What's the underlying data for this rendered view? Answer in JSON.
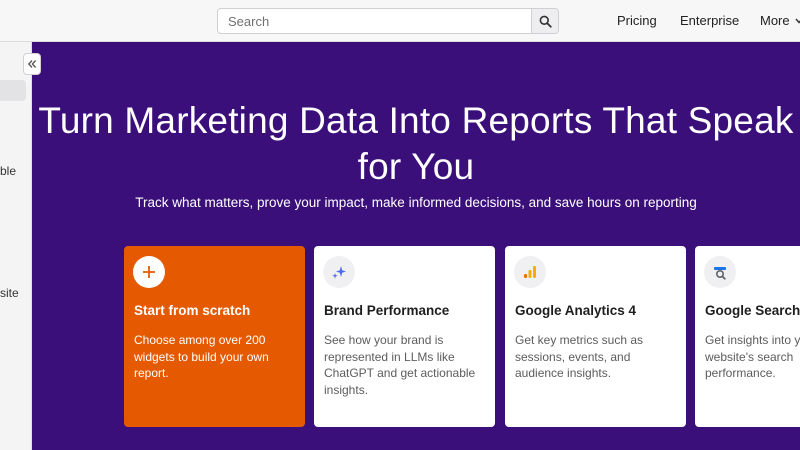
{
  "topbar": {
    "search": {
      "placeholder": "Search",
      "value": ""
    },
    "nav": {
      "pricing": "Pricing",
      "enterprise": "Enterprise",
      "more": "More"
    }
  },
  "sidebar": {
    "fragments": [
      "ble",
      "site"
    ]
  },
  "hero": {
    "title": "Turn Marketing Data Into Reports That Speak for You",
    "subtitle": "Track what matters, prove your impact, make informed decisions, and save hours on reporting"
  },
  "cards": [
    {
      "icon": "plus-icon",
      "title": "Start from scratch",
      "description": "Choose among over 200 widgets to build your own report."
    },
    {
      "icon": "sparkle-icon",
      "title": "Brand Performance",
      "description": "See how your brand is represented in LLMs like ChatGPT and get actionable insights."
    },
    {
      "icon": "google-analytics-icon",
      "title": "Google Analytics 4",
      "description": "Get key metrics such as sessions, events, and audience insights."
    },
    {
      "icon": "google-search-console-icon",
      "title": "Google Search",
      "description": "Get insights into your website's search performance."
    }
  ],
  "colors": {
    "hero_bg": "#3a0f7a",
    "accent_orange": "#e55a00",
    "ga_orange": "#f9ab00",
    "sparkle_blue": "#4f6bed"
  }
}
